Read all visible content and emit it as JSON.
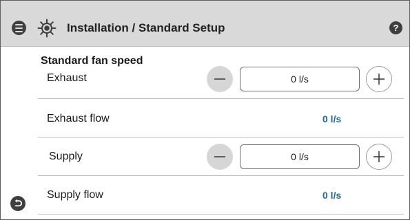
{
  "header": {
    "title": "Installation / Standard Setup",
    "menu_icon": "menu-icon",
    "settings_icon": "gear-icon",
    "help_icon": "help-icon",
    "help_glyph": "?",
    "background_color": "#d9d9d9"
  },
  "section": {
    "title": "Standard fan speed"
  },
  "exhaust": {
    "label": "Exhaust",
    "value": "0 l/s",
    "minus_icon": "minus-icon",
    "plus_icon": "plus-icon"
  },
  "exhaust_flow": {
    "label": "Exhaust flow",
    "value": "0 l/s"
  },
  "supply": {
    "label": "Supply",
    "value": "0 l/s",
    "minus_icon": "minus-icon",
    "plus_icon": "plus-icon"
  },
  "supply_flow": {
    "label": "Supply flow",
    "value": "0 l/s"
  },
  "footer": {
    "back_icon": "back-icon"
  },
  "colors": {
    "flow_value": "#1f6aa5",
    "icon_dark": "#3f3f3f"
  }
}
